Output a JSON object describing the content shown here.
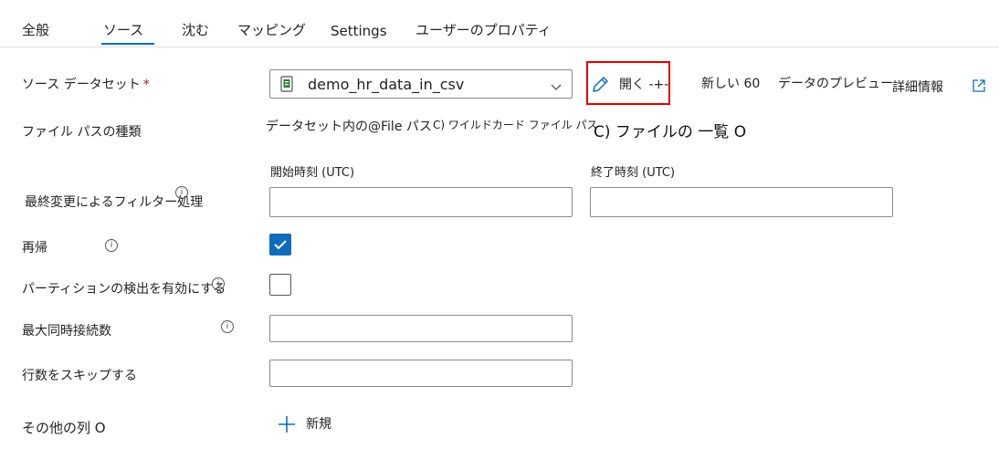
{
  "tabs": {
    "general": "全般",
    "source": "ソース",
    "sink": "沈む",
    "mapping": "マッピング",
    "settings": "Settings",
    "user_properties": "ユーザーのプロパティ"
  },
  "source_dataset": {
    "label": "ソース データセット",
    "required_marker": "*",
    "selected": "demo_hr_data_in_csv",
    "open_label": "開く -+-",
    "new_label": "新しい 60",
    "preview_label": "データのプレビュー",
    "details_label": "詳細情報"
  },
  "file_path_type": {
    "label": "ファイル パスの種類",
    "option1": "データセット内の@File パス",
    "option2": "C) ワイルドカード ファイル パス",
    "option3": "C) ファイルの 一覧 O"
  },
  "filter": {
    "label": "最終変更によるフィルター処理",
    "start_label": "開始時刻 (UTC)",
    "end_label": "終了時刻 (UTC)",
    "start_value": "",
    "end_value": ""
  },
  "recursive": {
    "label": "再帰",
    "checked": true
  },
  "partition_discovery": {
    "label": "パーティションの検出を有効にする",
    "checked": false
  },
  "max_connections": {
    "label": "最大同時接続数",
    "value": ""
  },
  "skip_lines": {
    "label": "行数をスキップする",
    "value": ""
  },
  "additional_columns": {
    "label": "その他の列 O",
    "new_label": "新規"
  },
  "colors": {
    "accent": "#0f6cbd",
    "highlight": "#e00000"
  }
}
